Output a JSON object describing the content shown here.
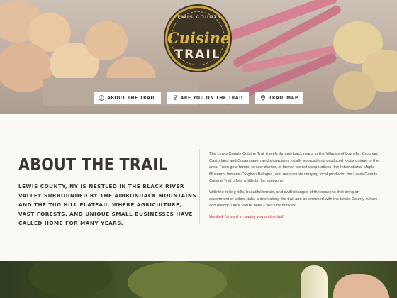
{
  "logo": {
    "top_text": "LEWIS COUNTY",
    "script": "Cuisine",
    "trail": "TRAIL"
  },
  "nav": {
    "items": [
      {
        "label": "ABOUT THE TRAIL",
        "icon": "info-icon"
      },
      {
        "label": "ARE YOU ON THE TRAIL",
        "icon": "wine-glass-icon"
      },
      {
        "label": "TRAIL MAP",
        "icon": "map-pin-icon"
      }
    ]
  },
  "about": {
    "title": "ABOUT THE TRAIL",
    "lede": "LEWIS COUNTY, NY IS NESTLED IN THE BLACK RIVER VALLEY SURROUNDED BY THE ADIRONDACK MOUNTAINS AND THE TUG HILL PLATEAU, WHERE AGRICULTURE, VAST FORESTS, AND UNIQUE SMALL BUSINESSES HAVE CALLED HOME FOR MANY YEARS.",
    "paragraph1": "The Lewis County Cuisine Trail travels through back roads to the Villages of Lowville, Croghan, Castorland and Copenhagen and showcases locally sourced and produced foods unique to the area. From goat farms, to cow dairies, to farmer owned cooperatives, the International Maple Museum, famous Croghan Bologna, and restaurants carrying local products, the Lewis County Cuisine Trail offers a little bit for everyone.",
    "paragraph2": "With the rolling hills, beautiful terrain, and swift changes of the seasons that bring an assortment of colors, take a drive along the trail and be enriched with the Lewis County culture and history. Once you're here – you'll be hooked.",
    "cta": "We look forward to seeing you on the trail!"
  },
  "colors": {
    "accent": "#c0392b",
    "logo_dark": "#3b3426",
    "logo_gold": "#c9a53c",
    "background": "#fbf9f4"
  }
}
